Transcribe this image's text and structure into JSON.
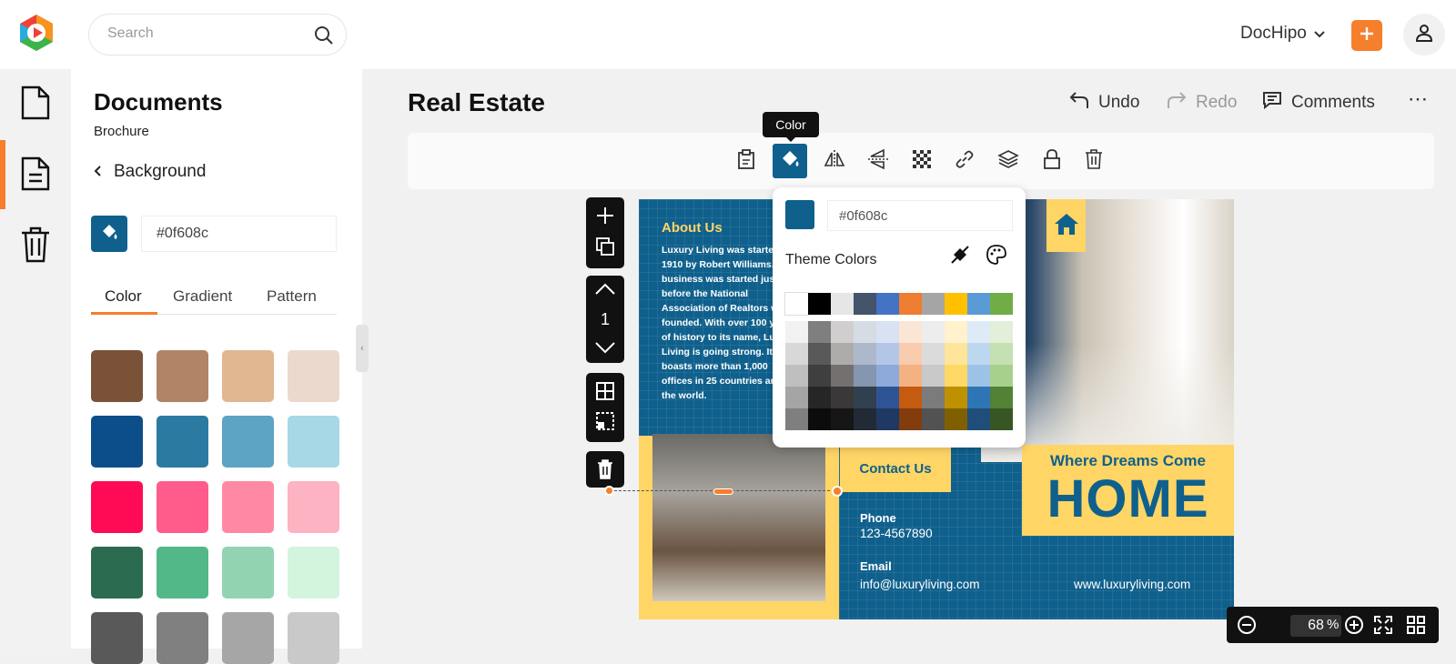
{
  "header": {
    "search_placeholder": "Search",
    "brand": "DocHipo"
  },
  "rail": {
    "items": [
      "document-icon",
      "template-icon",
      "trash-icon"
    ]
  },
  "panel": {
    "title": "Documents",
    "subtitle": "Brochure",
    "back_label": "Background",
    "hex_value": "#0f608c",
    "tabs": [
      {
        "label": "Color",
        "active": true
      },
      {
        "label": "Gradient",
        "active": false
      },
      {
        "label": "Pattern",
        "active": false
      }
    ],
    "swatches": [
      [
        "#7a5238",
        "#b08465",
        "#e0b791",
        "#ecd9cd"
      ],
      [
        "#0c4e8a",
        "#2b7aa2",
        "#5da3c4",
        "#a7d8e6"
      ],
      [
        "#ff0a55",
        "#ff5c8b",
        "#ff89a4",
        "#fdb3c1"
      ],
      [
        "#2b6c50",
        "#52b888",
        "#92d4b2",
        "#d3f4dd"
      ],
      [
        "#595959",
        "#808080",
        "#a6a6a6",
        "#c9c9c9"
      ]
    ]
  },
  "document": {
    "title": "Real Estate",
    "undo": "Undo",
    "redo": "Redo",
    "comments": "Comments"
  },
  "toolbar": {
    "tooltip": "Color",
    "active_tool": "color-button"
  },
  "sidetool": {
    "page_number": "1"
  },
  "brochure": {
    "about_title": "About Us",
    "about_body": "Luxury Living was started in 1910 by Robert Williams. The business was started just before the National Association of Realtors was founded. With over 100 years of history to its name, Luxury Living is going strong. It boasts more than 1,000 offices in 25 countries around the world.",
    "contact_title": "Contact Us",
    "tagline": "Where Dreams Come",
    "headline": "HOME",
    "phone_label": "Phone",
    "phone_value": "123-4567890",
    "email_label": "Email",
    "email_value": "info@luxuryliving.com",
    "website": "www.luxuryliving.com"
  },
  "picker": {
    "hex_value": "#0f608c",
    "theme_title": "Theme Colors",
    "theme_row": [
      "#ffffff",
      "#000000",
      "#e7e6e6",
      "#44546a",
      "#4472c4",
      "#ed7d31",
      "#a5a5a5",
      "#ffc000",
      "#5b9bd5",
      "#70ad47"
    ],
    "shade_rows": [
      [
        "#f2f2f2",
        "#7f7f7f",
        "#d0cece",
        "#d6dce4",
        "#d9e2f3",
        "#fbe5d5",
        "#ededed",
        "#fff2cc",
        "#deebf6",
        "#e2efd9"
      ],
      [
        "#d8d8d8",
        "#595959",
        "#aeabab",
        "#adb9ca",
        "#b4c6e7",
        "#f7cbac",
        "#dbdbdb",
        "#fee599",
        "#bdd7ee",
        "#c5e0b3"
      ],
      [
        "#bfbfbf",
        "#3f3f3f",
        "#757070",
        "#8496b0",
        "#8eaadb",
        "#f4b183",
        "#c9c9c9",
        "#ffd966",
        "#9cc3e5",
        "#a8d08d"
      ],
      [
        "#a5a5a5",
        "#262626",
        "#3a3838",
        "#323f4f",
        "#2f5496",
        "#c55a11",
        "#7b7b7b",
        "#bf9000",
        "#2e75b5",
        "#538135"
      ],
      [
        "#7f7f7f",
        "#0c0c0c",
        "#171616",
        "#222a35",
        "#1f3864",
        "#833c0b",
        "#525252",
        "#7f6000",
        "#1e4e79",
        "#375623"
      ]
    ]
  },
  "zoom": {
    "value": "68",
    "unit": "%"
  }
}
